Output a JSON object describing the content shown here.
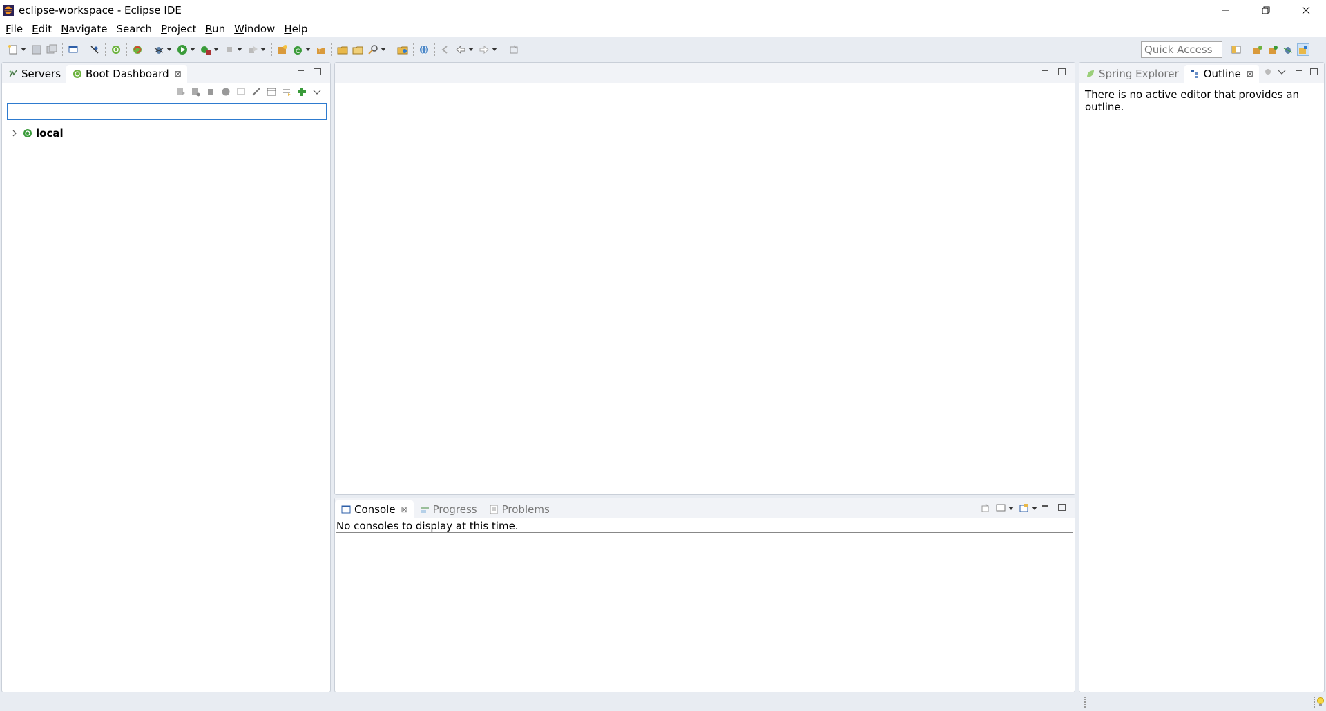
{
  "window": {
    "title": "eclipse-workspace - Eclipse IDE",
    "controls": [
      "minimize",
      "restore",
      "close"
    ]
  },
  "menu": [
    {
      "label": "File",
      "mnemonic": "F",
      "rest": "ile"
    },
    {
      "label": "Edit",
      "mnemonic": "E",
      "rest": "dit"
    },
    {
      "label": "Navigate",
      "mnemonic": "N",
      "rest": "avigate"
    },
    {
      "label": "Search",
      "mnemonic": "",
      "rest": "Search"
    },
    {
      "label": "Project",
      "mnemonic": "P",
      "rest": "roject"
    },
    {
      "label": "Run",
      "mnemonic": "R",
      "rest": "un"
    },
    {
      "label": "Window",
      "mnemonic": "W",
      "rest": "indow"
    },
    {
      "label": "Help",
      "mnemonic": "H",
      "rest": "elp"
    }
  ],
  "toolbar": {
    "quick_access_placeholder": "Quick Access"
  },
  "left_panel": {
    "tabs": [
      {
        "label": "Servers",
        "icon": "servers-icon",
        "active": false
      },
      {
        "label": "Boot Dashboard",
        "icon": "spring-boot-icon",
        "active": true
      }
    ],
    "filter_value": "",
    "tree": [
      {
        "label": "local",
        "icon": "spring-boot-icon",
        "expanded": false
      }
    ]
  },
  "right_panel": {
    "tabs": [
      {
        "label": "Spring Explorer",
        "icon": "spring-leaf-icon",
        "active": false
      },
      {
        "label": "Outline",
        "icon": "outline-icon",
        "active": true
      }
    ],
    "message": "There is no active editor that provides an outline."
  },
  "bottom_panel": {
    "tabs": [
      {
        "label": "Console",
        "icon": "console-icon",
        "active": true
      },
      {
        "label": "Progress",
        "icon": "progress-icon",
        "active": false
      },
      {
        "label": "Problems",
        "icon": "problems-icon",
        "active": false
      }
    ],
    "message": "No consoles to display at this time."
  },
  "colors": {
    "accent": "#2e7bcf",
    "spring_green": "#6db33f",
    "chrome_bg": "#e8ecf2"
  }
}
